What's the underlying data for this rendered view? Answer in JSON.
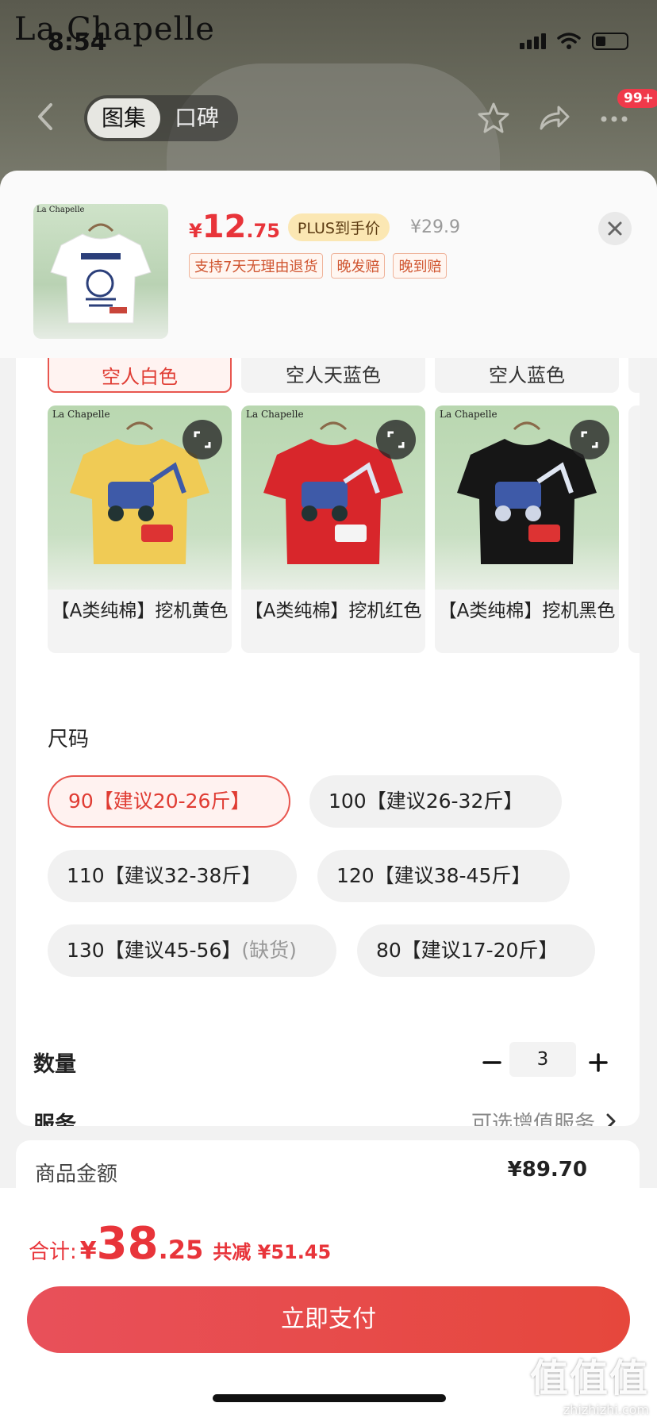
{
  "status_bar": {
    "time": "8:54"
  },
  "background": {
    "brand": "La Chapelle",
    "tabs": [
      {
        "label": "图集"
      },
      {
        "label": "口碑"
      }
    ],
    "cart_badge": "99+"
  },
  "product_header": {
    "thumb_brand": "La Chapelle",
    "price_symbol": "¥",
    "price_int": "12",
    "price_dec": ".75",
    "plus_tag": "PLUS到手价",
    "original_price": "¥29.9",
    "tags": [
      "支持7天无理由退货",
      "晚发赔",
      "晚到赔"
    ]
  },
  "colors": {
    "prev_row": [
      {
        "name": "空人白色",
        "selected": true
      },
      {
        "name": "空人天蓝色",
        "selected": false
      },
      {
        "name": "空人蓝色",
        "selected": false
      }
    ],
    "items": [
      {
        "brand": "La Chapelle",
        "name": "【A类纯棉】挖机黄色",
        "shirt_color": "#f0cb55"
      },
      {
        "brand": "La Chapelle",
        "name": "【A类纯棉】挖机红色",
        "shirt_color": "#d8262b"
      },
      {
        "brand": "La Chapelle",
        "name": "【A类纯棉】挖机黑色",
        "shirt_color": "#161616"
      }
    ]
  },
  "size": {
    "title": "尺码",
    "options": [
      {
        "label": "90【建议20-26斤】",
        "selected": true
      },
      {
        "label": "100【建议26-32斤】",
        "selected": false
      },
      {
        "label": "110【建议32-38斤】",
        "selected": false
      },
      {
        "label": "120【建议38-45斤】",
        "selected": false
      },
      {
        "label": "130【建议45-56】",
        "suffix": "(缺货)",
        "selected": false
      },
      {
        "label": "80【建议17-20斤】",
        "selected": false
      }
    ]
  },
  "quantity": {
    "label": "数量",
    "value": "3"
  },
  "service": {
    "label": "服务",
    "value": "可选增值服务"
  },
  "summary": {
    "label": "商品金额",
    "value": "¥89.70"
  },
  "footer": {
    "total_label": "合计:",
    "total_symbol": "¥",
    "total_int": "38",
    "total_dec": ".25",
    "total_save": "共减 ¥51.45",
    "pay_label": "立即支付"
  },
  "watermark": {
    "big": "值值值",
    "small": "zhizhizhi.com"
  },
  "theme": {
    "accent": "#e8343a",
    "plus_bg": "#fbe7b3"
  }
}
